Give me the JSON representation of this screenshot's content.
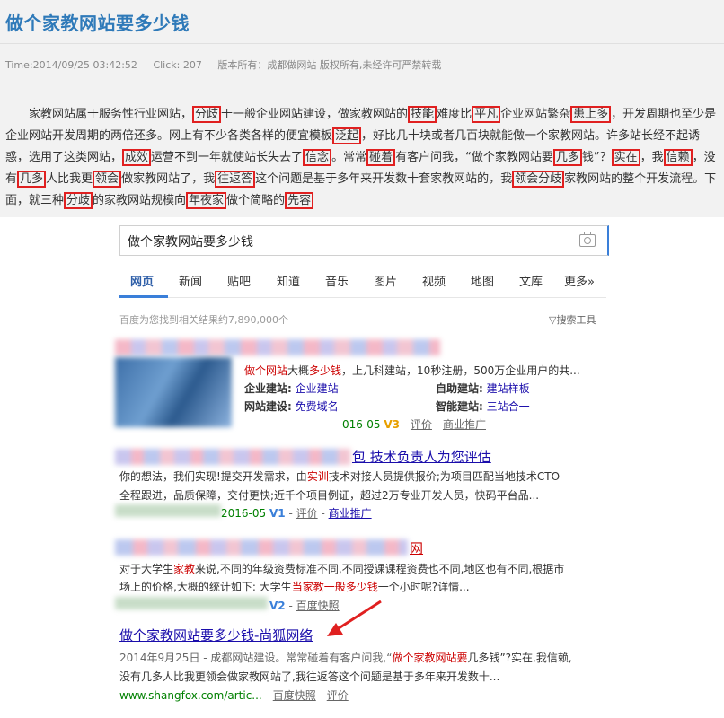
{
  "article": {
    "title": "做个家教网站要多少钱",
    "meta": {
      "time": "Time:2014/09/25 03:42:52",
      "click": "Click: 207",
      "rights": "版本所有：成都做网站  版权所有,未经许可严禁转载"
    },
    "paragraph": [
      {
        "t": "家教网站属于服务性行业网站，"
      },
      {
        "t": "分歧",
        "h": 1
      },
      {
        "t": "于一般企业网站建设，做家教网站的"
      },
      {
        "t": "技能",
        "h": 1
      },
      {
        "t": "难度比"
      },
      {
        "t": "平凡",
        "h": 1
      },
      {
        "t": "企业网站繁杂"
      },
      {
        "t": "患上多",
        "h": 1
      },
      {
        "t": "，开发周期也至少是企业网站开发周期的两倍还多。网上有不少各类各样的便宜模板"
      },
      {
        "t": "泛起",
        "h": 1
      },
      {
        "t": "，好比几十块或者几百块就能做一个家教网站。许多站长经不起诱惑，选用了这类网站，"
      },
      {
        "t": "成效",
        "h": 1
      },
      {
        "t": "运营不到一年就使站长失去了"
      },
      {
        "t": "信念",
        "h": 1
      },
      {
        "t": "。常常"
      },
      {
        "t": "碰着",
        "h": 1
      },
      {
        "t": "有客户问我，“做个家教网站要"
      },
      {
        "t": "几多",
        "h": 1
      },
      {
        "t": "钱”？"
      },
      {
        "t": "实在",
        "h": 1
      },
      {
        "t": "，我"
      },
      {
        "t": "信赖",
        "h": 1
      },
      {
        "t": "，没有"
      },
      {
        "t": "几多",
        "h": 1
      },
      {
        "t": "人比我更"
      },
      {
        "t": "领会",
        "h": 1
      },
      {
        "t": "做家教网站了，我"
      },
      {
        "t": "往返答",
        "h": 1
      },
      {
        "t": "这个问题是基于多年来开发数十套家教网站的，我"
      },
      {
        "t": "领会分歧",
        "h": 1
      },
      {
        "t": "家教网站的整个开发流程。下面，就三种"
      },
      {
        "t": "分歧",
        "h": 1
      },
      {
        "t": "的家教网站规模向"
      },
      {
        "t": "年夜家",
        "h": 1
      },
      {
        "t": "做个简略的"
      },
      {
        "t": "先容",
        "h": 1
      },
      {
        "t": ""
      }
    ]
  },
  "search": {
    "query": "做个家教网站要多少钱",
    "tabs": [
      "网页",
      "新闻",
      "贴吧",
      "知道",
      "音乐",
      "图片",
      "视频",
      "地图",
      "文库",
      "更多»"
    ],
    "count": "百度为您找到相关结果约7,890,000个",
    "tools": "▽搜索工具"
  },
  "results": {
    "r1": {
      "desc_title": "做个网站",
      "desc_rest": "大概",
      "desc_red2": "多少钱",
      "desc_tail": "，上几科建站，10秒注册，500万企业用户的共...",
      "l1": "企业建站:",
      "v1": "企业建站",
      "l2": "自助建站:",
      "v2": "建站样板",
      "l3": "网站建设:",
      "v3": "免费域名",
      "l4": "智能建站:",
      "v4": "三站合一",
      "date": "016-05",
      "v": "V3",
      "eval": "评价",
      "promo": "商业推广"
    },
    "r2": {
      "title": "包 技术负责人为您评估",
      "line1a": "你的想法，我们实现!提交开发需求，由",
      "line1b": "实训",
      "line1c": "技术对接人员提供报价;为项目匹配当地技术CTO",
      "line2": "全程跟进，品质保障，交付更快;近千个项目例证，超过2万专业开发人员，快码平台品...",
      "date": "2016-05",
      "v": "V1",
      "eval": "评价",
      "promo": "商业推广"
    },
    "r3": {
      "title": "网",
      "line1a": "对于大学生",
      "line1b": "家教",
      "line1c": "来说,不同的年级资费标准不同,不同授课课程资费也不同,地区也有不同,根据市",
      "line2a": "场上的价格,大概的统计如下: 大学生",
      "line2b": "当家教一般多少钱",
      "line2c": "一个小时呢?详情...",
      "v": "V2",
      "snap": "百度快照"
    },
    "r4": {
      "title": "做个家教网站要多少钱-尚狐网络",
      "line1a": "2014年9月25日 - 成都网站建设。常常碰着有客户问我,“",
      "line1b": "做个家教网站要",
      "line1c": "几多钱”?实在,我信赖,",
      "line2": "没有几多人比我更领会做家教网站了,我往返答这个问题是基于多年来开发数十...",
      "url": "www.shangfox.com/artic...",
      "snap": "百度快照",
      "eval": "评价"
    }
  }
}
